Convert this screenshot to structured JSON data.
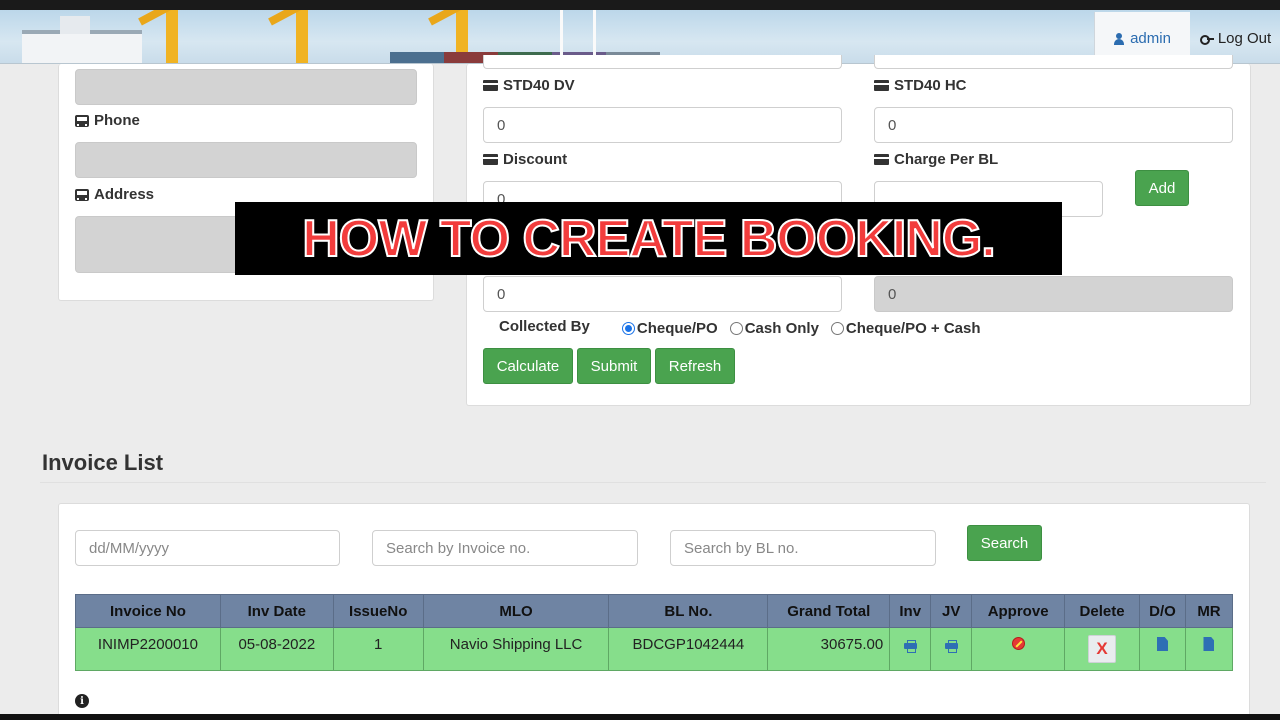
{
  "header": {
    "user_label": "admin",
    "logout_label": "Log Out"
  },
  "customer": {
    "phone_label": "Phone",
    "address_label": "Address"
  },
  "charges": {
    "std40dv_label": "STD40 DV",
    "std40dv_value": "0",
    "std40hc_label": "STD40 HC",
    "std40hc_value": "0",
    "discount_label": "Discount",
    "discount_value": "0",
    "charge_per_bl_label": "Charge Per BL",
    "charge_per_bl_value": "",
    "add_label": "Add",
    "lower_left_value": "0",
    "lower_right_value": "0",
    "collected_by_label": "Collected By",
    "collected_options": [
      "Cheque/PO",
      "Cash Only",
      "Cheque/PO + Cash"
    ],
    "collected_selected": "Cheque/PO",
    "calculate_label": "Calculate",
    "submit_label": "Submit",
    "refresh_label": "Refresh"
  },
  "overlay": {
    "caption": "HOW TO CREATE BOOKING."
  },
  "invoice_list": {
    "title": "Invoice List",
    "date_placeholder": "dd/MM/yyyy",
    "invoice_placeholder": "Search by Invoice no.",
    "bl_placeholder": "Search by BL no.",
    "search_label": "Search",
    "columns": [
      "Invoice No",
      "Inv Date",
      "IssueNo",
      "MLO",
      "BL No.",
      "Grand Total",
      "Inv",
      "JV",
      "Approve",
      "Delete",
      "D/O",
      "MR"
    ],
    "rows": [
      {
        "invoice_no": "INIMP2200010",
        "inv_date": "05-08-2022",
        "issue_no": "1",
        "mlo": "Navio Shipping LLC",
        "bl_no": "BDCGP1042444",
        "grand_total": "30675.00",
        "delete_label": "X"
      }
    ]
  },
  "colors": {
    "button_green": "#4aa34f",
    "table_header": "#6f84a3",
    "row_green": "#86de8b",
    "caption_red": "#f23c3c",
    "link_blue": "#2b6cb0"
  }
}
